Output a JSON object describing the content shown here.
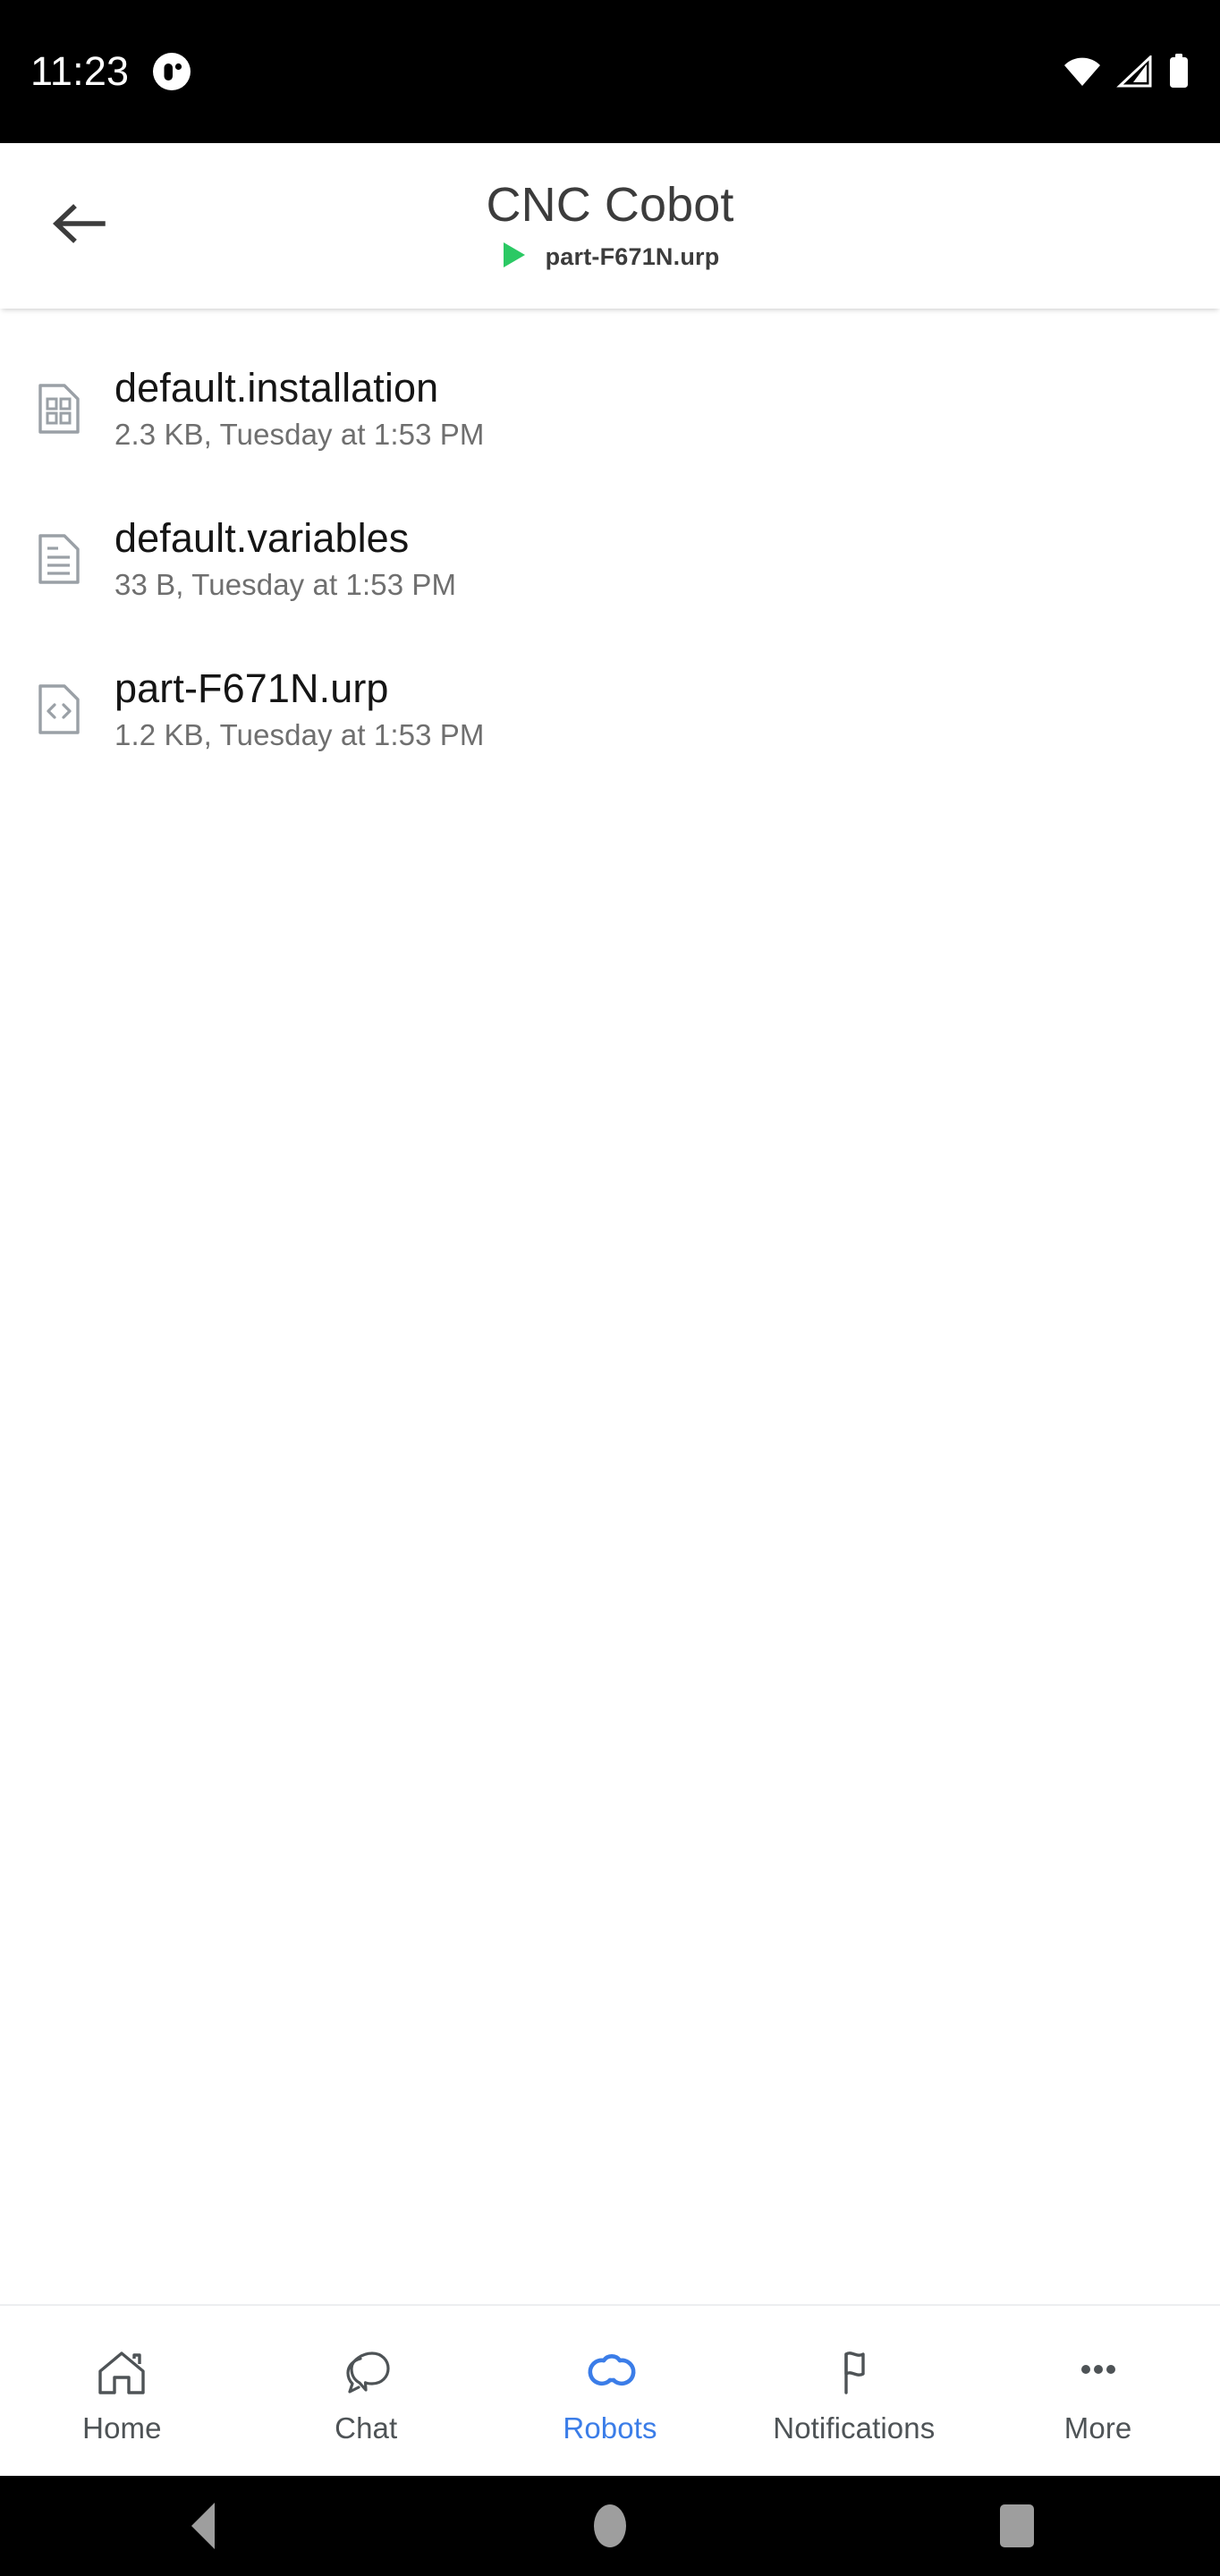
{
  "status_bar": {
    "time": "11:23",
    "app_icon": "robot-notification-icon",
    "wifi_icon": "wifi-icon",
    "signal_icon": "cellular-signal-icon",
    "battery_icon": "battery-full-icon",
    "background_color": "#000000",
    "foreground_color": "#ffffff"
  },
  "header": {
    "back_icon": "back-arrow-icon",
    "title": "CNC Cobot",
    "program_play_icon": "play-icon",
    "program_name": "part-F671N.urp",
    "play_color": "#2BC964"
  },
  "file_list": {
    "items": [
      {
        "icon": "binary-file-icon",
        "name": "default.installation",
        "meta": "2.3 KB, Tuesday at 1:53 PM"
      },
      {
        "icon": "text-file-icon",
        "name": "default.variables",
        "meta": "33 B, Tuesday at 1:53 PM"
      },
      {
        "icon": "code-file-icon",
        "name": "part-F671N.urp",
        "meta": "1.2 KB, Tuesday at 1:53 PM"
      }
    ]
  },
  "bottom_nav": {
    "active_color": "#3B7DE8",
    "inactive_color": "#4e5356",
    "items": [
      {
        "icon": "home-icon",
        "label": "Home",
        "active": false
      },
      {
        "icon": "chat-icon",
        "label": "Chat",
        "active": false
      },
      {
        "icon": "robots-icon",
        "label": "Robots",
        "active": true
      },
      {
        "icon": "notifications-flag-icon",
        "label": "Notifications",
        "active": false
      },
      {
        "icon": "more-dots-icon",
        "label": "More",
        "active": false
      }
    ]
  },
  "system_nav": {
    "back_icon": "system-back-icon",
    "home_icon": "system-home-icon",
    "recents_icon": "system-recents-icon"
  }
}
